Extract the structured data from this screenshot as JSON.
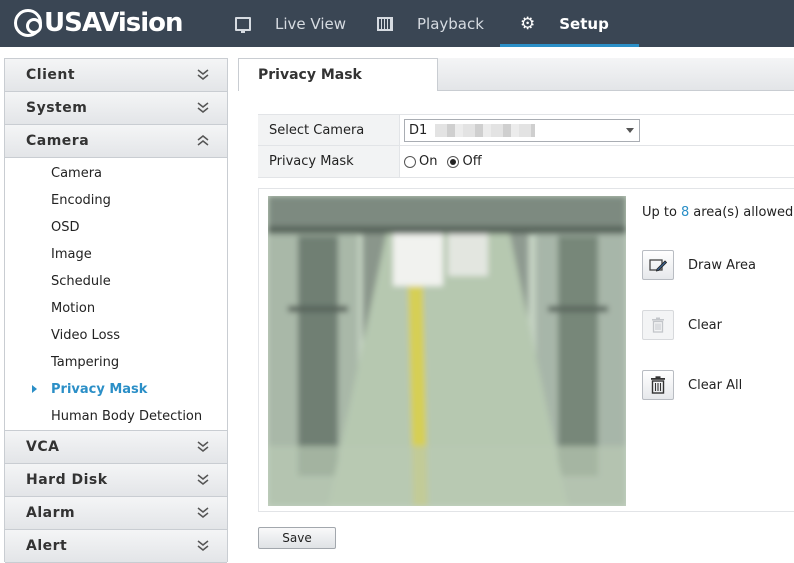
{
  "brand": {
    "name": "USAVision",
    "sub": "®"
  },
  "nav": {
    "live_view": "Live View",
    "playback": "Playback",
    "setup": "Setup"
  },
  "sidebar": {
    "sections": {
      "client": "Client",
      "system": "System",
      "camera": "Camera",
      "vca": "VCA",
      "hard_disk": "Hard Disk",
      "alarm": "Alarm",
      "alert": "Alert"
    },
    "camera_items": [
      "Camera",
      "Encoding",
      "OSD",
      "Image",
      "Schedule",
      "Motion",
      "Video Loss",
      "Tampering",
      "Privacy Mask",
      "Human Body Detection"
    ],
    "active_item": "Privacy Mask"
  },
  "tab": {
    "title": "Privacy Mask"
  },
  "form": {
    "select_camera_label": "Select Camera",
    "select_camera_value": "D1",
    "privacy_mask_label": "Privacy Mask",
    "on_label": "On",
    "off_label": "Off",
    "selected": "Off"
  },
  "tools": {
    "allowed_prefix": "Up to",
    "allowed_count": "8",
    "allowed_suffix": "area(s) allowed",
    "draw_area": "Draw Area",
    "clear": "Clear",
    "clear_all": "Clear All"
  },
  "save_label": "Save",
  "colors": {
    "accent": "#2b8fc7",
    "topbar": "#3a4654"
  }
}
